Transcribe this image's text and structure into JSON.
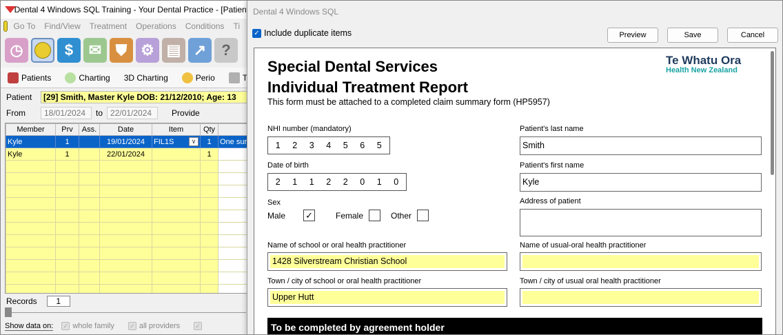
{
  "app": {
    "title": "Dental 4 Windows SQL Training - Your Dental Practice  - [Patient",
    "menu": [
      "Go To",
      "Find/View",
      "Treatment",
      "Operations",
      "Conditions",
      "Ti"
    ],
    "toolbar_icons": [
      "clock-icon",
      "smiley-icon",
      "dollar-icon",
      "mail-icon",
      "shield-icon",
      "gears-icon",
      "printer-icon",
      "chart-icon",
      "help-icon"
    ],
    "tabs": [
      "Patients",
      "Charting",
      "3D Charting",
      "Perio",
      "T"
    ],
    "patient_label": "Patient",
    "patient_value": "[29] Smith, Master Kyle DOB: 21/12/2010; Age: 13",
    "from_label": "From",
    "from_date": "18/01/2024",
    "to_label": "to",
    "to_date": "22/01/2024",
    "provider_label": "Provide",
    "grid": {
      "headers": [
        "Member",
        "Prv",
        "Ass.",
        "Date",
        "Item",
        "Qty",
        ""
      ],
      "rows": [
        [
          "Kyle",
          "1",
          "",
          "19/01/2024",
          "FIL1S",
          "1",
          "One sur"
        ],
        [
          "Kyle",
          "1",
          "",
          "22/01/2024",
          "",
          "1",
          ""
        ]
      ]
    },
    "records_label": "Records",
    "records_count": "1",
    "show_data_label": "Show data on:",
    "show_options": [
      "whole family",
      "all providers"
    ]
  },
  "dialog": {
    "title": "Dental 4 Windows SQL",
    "include_duplicates_label": "Include duplicate items",
    "preview_label": "Preview",
    "save_label": "Save",
    "cancel_label": "Cancel"
  },
  "form": {
    "title_line1": "Special Dental Services",
    "title_line2": "Individual Treatment Report",
    "subtitle": "This form must be attached to a completed claim summary form (HP5957)",
    "brand_name": "Te Whatu Ora",
    "brand_sub": "Health New Zealand",
    "nhi_label": "NHI number (mandatory)",
    "nhi_digits": [
      "1",
      "2",
      "3",
      "4",
      "5",
      "6",
      "5"
    ],
    "dob_label": "Date of birth",
    "dob_digits": [
      "2",
      "1",
      "1",
      "2",
      "2",
      "0",
      "1",
      "0"
    ],
    "sex_label": "Sex",
    "sex_male": "Male",
    "sex_male_mark": "✓",
    "sex_female": "Female",
    "sex_other": "Other",
    "last_name_label": "Patient's last name",
    "last_name": "Smith",
    "first_name_label": "Patient's first name",
    "first_name": "Kyle",
    "address_label": "Address of patient",
    "address": "",
    "school_label": "Name of school or oral health practitioner",
    "school": "1428 Silverstream Christian School",
    "usual_label": "Name of usual-oral health practitioner",
    "usual": "",
    "town_label": "Town / city of school or oral health practitioner",
    "town": "Upper Hutt",
    "usual_town_label": "Town / city of usual oral health practitioner",
    "usual_town": "",
    "agreement_header": "To be completed by agreement holder"
  }
}
